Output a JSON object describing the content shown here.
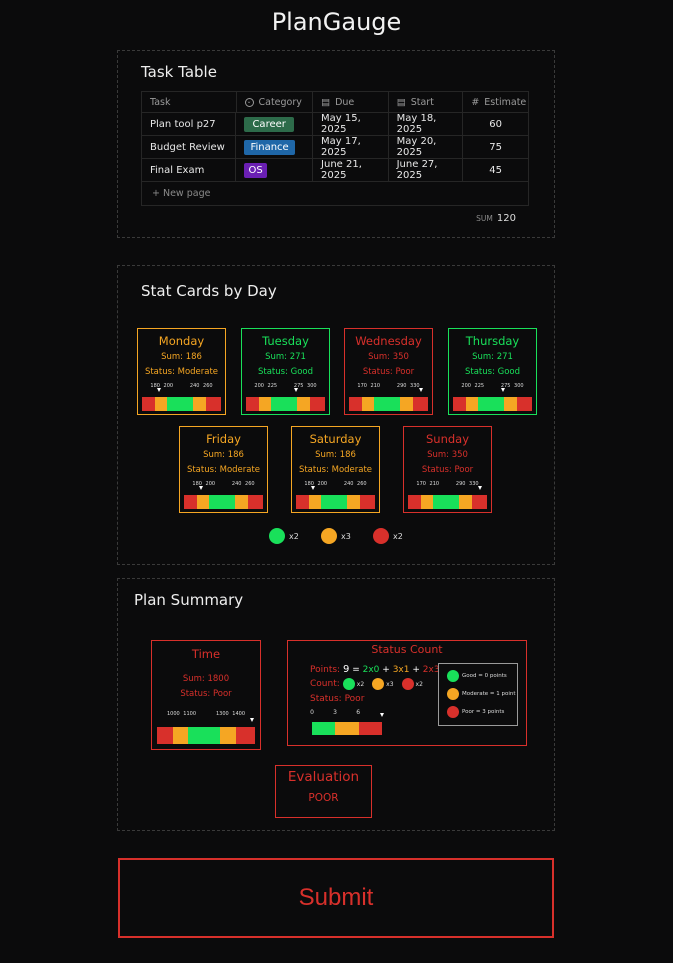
{
  "app": {
    "title": "PlanGauge"
  },
  "task_table": {
    "title": "Task Table",
    "headers": {
      "task": "Task",
      "category": "Category",
      "due": "Due",
      "start": "Start",
      "estimate": "Estimate"
    },
    "header_icons": {
      "category": "circle-chevron-icon",
      "due": "calendar-icon",
      "start": "calendar-icon",
      "estimate": "hash-icon"
    },
    "header_glyphs": {
      "category": "⌄",
      "due": "▤",
      "start": "▤",
      "estimate": "#"
    },
    "rows": [
      {
        "task": "Plan tool p27",
        "category": "Career",
        "category_color": "#2d6b4a",
        "due": "May 15, 2025",
        "start": "May 18, 2025",
        "estimate": "60"
      },
      {
        "task": "Budget Review",
        "category": "Finance",
        "category_color": "#1f67a8",
        "due": "May 17, 2025",
        "start": "May 20, 2025",
        "estimate": "75"
      },
      {
        "task": "Final Exam",
        "category": "OS",
        "category_color": "#6a1fb3",
        "due": "June 21, 2025",
        "start": "June 27, 2025",
        "estimate": "45"
      }
    ],
    "new_page_label": "+ New page",
    "sum_label": "SUM",
    "sum_value": "120"
  },
  "stat_cards": {
    "title": "Stat Cards by Day",
    "cards": [
      {
        "day": "Monday",
        "sum": "Sum: 186",
        "status": "Status: Moderate",
        "color": "#f5a623",
        "ticks": [
          "180",
          "200",
          "240",
          "260"
        ],
        "value": 186
      },
      {
        "day": "Tuesday",
        "sum": "Sum: 271",
        "status": "Status: Good",
        "color": "#19e05a",
        "ticks": [
          "200",
          "225",
          "275",
          "300"
        ],
        "value": 271
      },
      {
        "day": "Wednesday",
        "sum": "Sum: 350",
        "status": "Status: Poor",
        "color": "#d8302b",
        "ticks": [
          "170",
          "210",
          "290",
          "330"
        ],
        "value": 350
      },
      {
        "day": "Thursday",
        "sum": "Sum: 271",
        "status": "Status: Good",
        "color": "#19e05a",
        "ticks": [
          "200",
          "225",
          "275",
          "300"
        ],
        "value": 271
      },
      {
        "day": "Friday",
        "sum": "Sum: 186",
        "status": "Status: Moderate",
        "color": "#f5a623",
        "ticks": [
          "180",
          "200",
          "240",
          "260"
        ],
        "value": 186
      },
      {
        "day": "Saturday",
        "sum": "Sum: 186",
        "status": "Status: Moderate",
        "color": "#f5a623",
        "ticks": [
          "180",
          "200",
          "240",
          "260"
        ],
        "value": 186
      },
      {
        "day": "Sunday",
        "sum": "Sum: 350",
        "status": "Status: Poor",
        "color": "#d8302b",
        "ticks": [
          "170",
          "210",
          "290",
          "330"
        ],
        "value": 350
      }
    ],
    "legend": [
      {
        "color": "#19e05a",
        "label": "x2"
      },
      {
        "color": "#f5a623",
        "label": "x3"
      },
      {
        "color": "#d8302b",
        "label": "x2"
      }
    ]
  },
  "plan_summary": {
    "title": "Plan Summary",
    "time": {
      "title": "Time",
      "sum": "Sum: 1800",
      "status": "Status: Poor",
      "ticks": [
        "1000",
        "1100",
        "1300",
        "1400"
      ],
      "value": 1800
    },
    "status_count": {
      "title": "Status Count",
      "points_label": "Points:",
      "points_value": "9",
      "eq": "=",
      "term_good": "2x0",
      "plus1": "+",
      "term_moderate": "3x1",
      "plus2": "+",
      "term_poor": "2x3",
      "count_label": "Count:",
      "count_good": "x2",
      "count_moderate": "x3",
      "count_poor": "x2",
      "status": "Status: Poor",
      "ticks": [
        "0",
        "3",
        "6"
      ],
      "value": 9,
      "legend": [
        "Good = 0 points",
        "Moderate = 1 point",
        "Poor = 3 points"
      ]
    },
    "evaluation": {
      "title": "Evaluation",
      "value": "POOR"
    }
  },
  "submit_label": "Submit",
  "colors": {
    "good": "#19e05a",
    "moderate": "#f5a623",
    "poor": "#d8302b"
  }
}
